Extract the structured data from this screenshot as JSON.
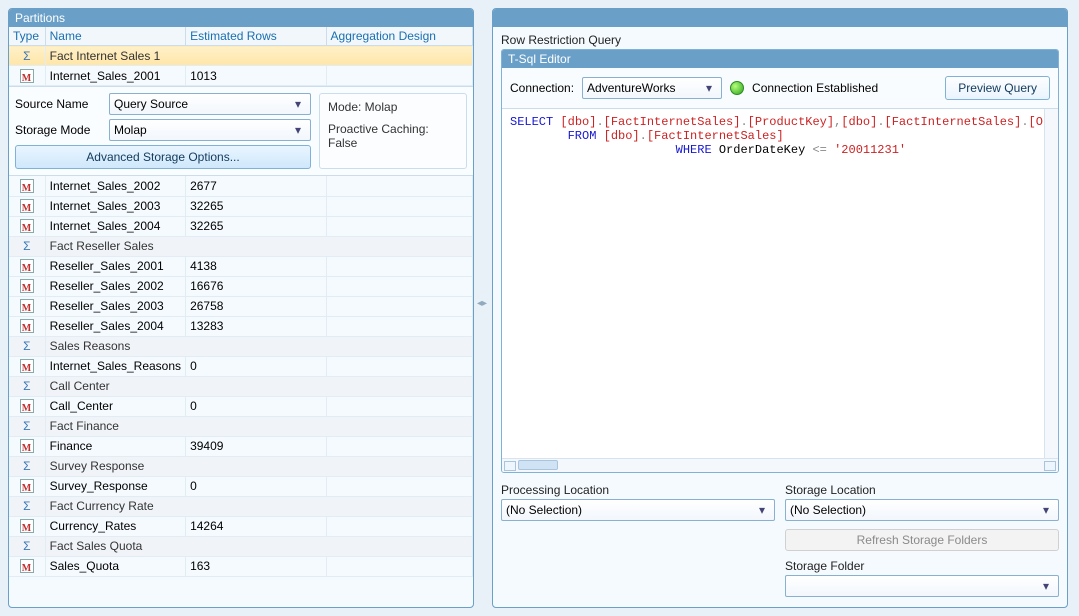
{
  "left": {
    "title": "Partitions",
    "columns": {
      "type": "Type",
      "name": "Name",
      "rows": "Estimated Rows",
      "agg": "Aggregation Design"
    },
    "selectedGroup": "Fact Internet Sales 1",
    "selectedRow": {
      "name": "Internet_Sales_2001",
      "rows": "1013"
    },
    "detail": {
      "sourceNameLabel": "Source Name",
      "sourceNameValue": "Query Source",
      "storageModeLabel": "Storage Mode",
      "storageModeValue": "Molap",
      "advancedButton": "Advanced Storage Options...",
      "modeLine": "Mode: Molap",
      "cacheLine": "Proactive Caching: False"
    },
    "restRows": [
      {
        "type": "m",
        "name": "Internet_Sales_2002",
        "rows": "2677"
      },
      {
        "type": "m",
        "name": "Internet_Sales_2003",
        "rows": "32265"
      },
      {
        "type": "m",
        "name": "Internet_Sales_2004",
        "rows": "32265"
      },
      {
        "type": "group",
        "name": "Fact Reseller Sales"
      },
      {
        "type": "m",
        "name": "Reseller_Sales_2001",
        "rows": "4138"
      },
      {
        "type": "m",
        "name": "Reseller_Sales_2002",
        "rows": "16676"
      },
      {
        "type": "m",
        "name": "Reseller_Sales_2003",
        "rows": "26758"
      },
      {
        "type": "m",
        "name": "Reseller_Sales_2004",
        "rows": "13283"
      },
      {
        "type": "group",
        "name": "Sales Reasons"
      },
      {
        "type": "m",
        "name": "Internet_Sales_Reasons",
        "rows": "0"
      },
      {
        "type": "group",
        "name": "Call Center"
      },
      {
        "type": "m",
        "name": "Call_Center",
        "rows": "0"
      },
      {
        "type": "group",
        "name": "Fact Finance"
      },
      {
        "type": "m",
        "name": "Finance",
        "rows": "39409"
      },
      {
        "type": "group",
        "name": "Survey Response"
      },
      {
        "type": "m",
        "name": "Survey_Response",
        "rows": "0"
      },
      {
        "type": "group",
        "name": "Fact Currency Rate"
      },
      {
        "type": "m",
        "name": "Currency_Rates",
        "rows": "14264"
      },
      {
        "type": "group",
        "name": "Fact Sales Quota"
      },
      {
        "type": "m",
        "name": "Sales_Quota",
        "rows": "163"
      }
    ]
  },
  "right": {
    "sectionTitle": "Row Restriction Query",
    "editorTitle": "T-Sql Editor",
    "connectionLabel": "Connection:",
    "connectionValue": "AdventureWorks",
    "statusText": "Connection Established",
    "previewBtn": "Preview Query",
    "sql": {
      "line1a": "SELECT ",
      "line1b": "[dbo]",
      "line1c": ".",
      "line1d": "[FactInternetSales]",
      "line1e": ".",
      "line1f": "[ProductKey]",
      "line1g": ",",
      "line1h": "[dbo]",
      "line1i": ".",
      "line1j": "[FactInternetSales]",
      "line1k": ".",
      "line1l": "[Order",
      "line2a": "FROM ",
      "line2b": "[dbo]",
      "line2c": ".",
      "line2d": "[FactInternetSales]",
      "line3a": "WHERE ",
      "line3b": "OrderDateKey ",
      "line3c": "<=",
      "line3d": " '20011231'"
    },
    "processingLabel": "Processing Location",
    "processingValue": "(No Selection)",
    "storageLocLabel": "Storage Location",
    "storageLocValue": "(No Selection)",
    "refreshBtn": "Refresh Storage Folders",
    "storageFolderLabel": "Storage Folder",
    "storageFolderValue": ""
  }
}
